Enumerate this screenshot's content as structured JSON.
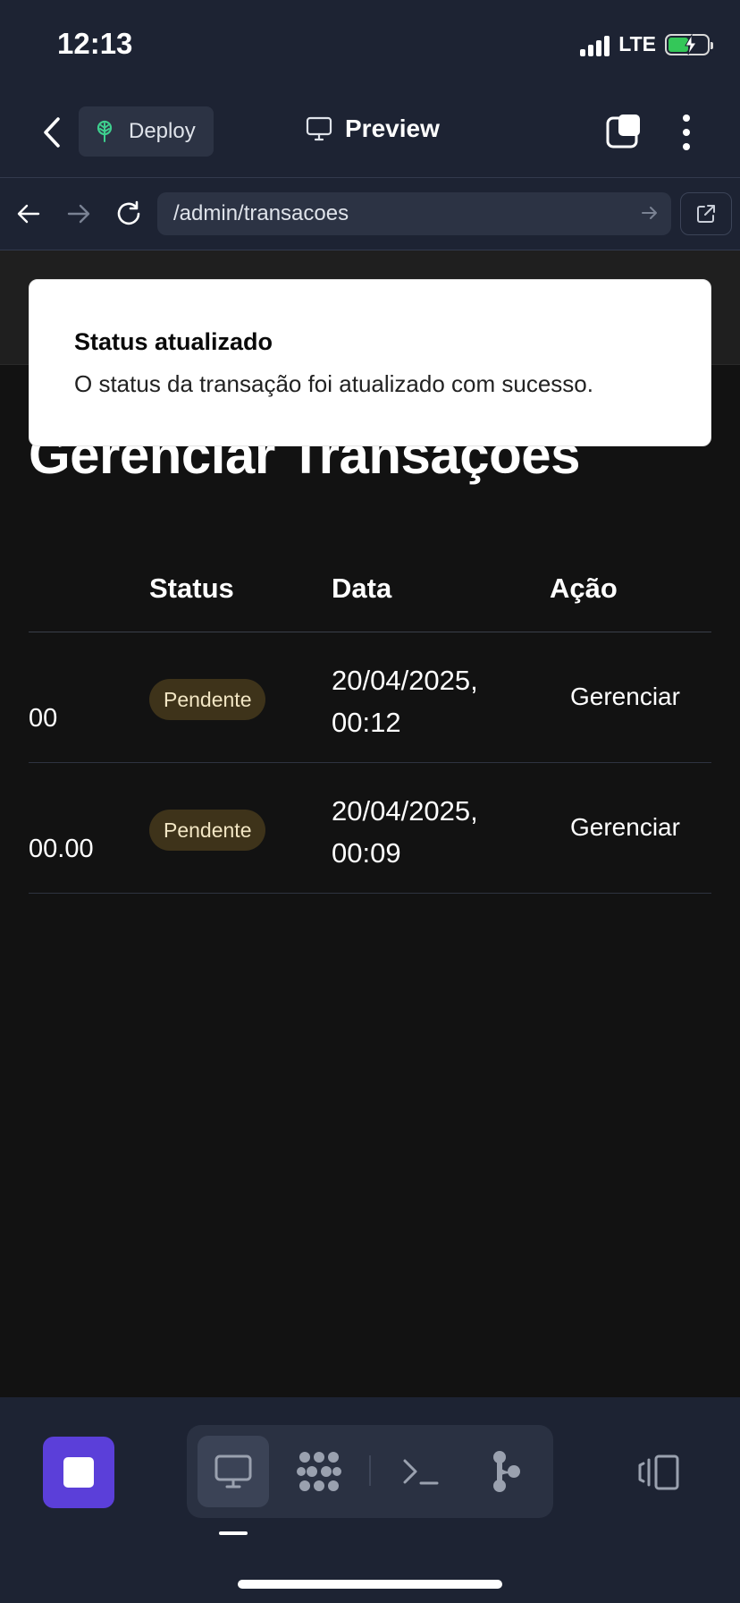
{
  "status_bar": {
    "time": "12:13",
    "network": "LTE"
  },
  "header": {
    "deploy_label": "Deploy",
    "preview_label": "Preview"
  },
  "url_bar": {
    "url": "/admin/transacoes"
  },
  "page": {
    "title": "Gerenciar Transações"
  },
  "table": {
    "columns": [
      "Status",
      "Data",
      "Ação"
    ],
    "rows": [
      {
        "amount": "00",
        "status": "Pendente",
        "date_line1": "20/04/2025,",
        "date_line2": "00:12",
        "action": "Gerenciar"
      },
      {
        "amount": "00.00",
        "status": "Pendente",
        "date_line1": "20/04/2025,",
        "date_line2": "00:09",
        "action": "Gerenciar"
      }
    ]
  },
  "toast": {
    "title": "Status atualizado",
    "description": "O status da transação foi atualizado com sucesso."
  },
  "dock": {
    "icons": [
      "stop-icon",
      "monitor-icon",
      "grid-dots-icon",
      "terminal-icon",
      "branch-icon",
      "device-switch-icon"
    ]
  },
  "colors": {
    "accent": "#5b3fd9",
    "header_bg": "#1d2333",
    "page_bg": "#121212",
    "badge_bg": "#3e331a"
  }
}
